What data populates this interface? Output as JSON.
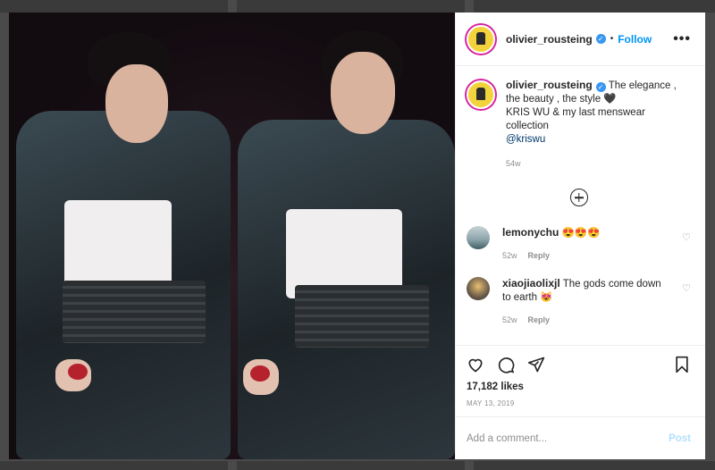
{
  "post": {
    "username": "olivier_rousteing",
    "follow_label": "Follow",
    "separator": "•",
    "more_label": "•••",
    "caption_text": "The elegance , the beauty , the style 🖤",
    "caption_line2": "KRIS WU & my last menswear collection",
    "caption_mention": "@kriswu",
    "caption_time": "54w",
    "likes": "17,182 likes",
    "date": "MAY 13, 2019"
  },
  "comments": [
    {
      "user": "lemonychu",
      "text": "😍😍😍",
      "time": "52w",
      "reply": "Reply"
    },
    {
      "user": "xiaojiaolixjl",
      "text": "The gods come down to earth 😻",
      "time": "52w",
      "reply": "Reply"
    }
  ],
  "add_comment": {
    "placeholder": "Add a comment...",
    "post_label": "Post"
  },
  "icons": [
    "like-icon",
    "comment-icon",
    "share-icon",
    "save-icon",
    "add-circle-icon",
    "verified-badge-icon",
    "comment-heart-icon"
  ],
  "colors": {
    "link": "#0095f6",
    "verified": "#3897f0",
    "post_disabled": "#b2dffc",
    "muted": "#8e8e8e"
  }
}
